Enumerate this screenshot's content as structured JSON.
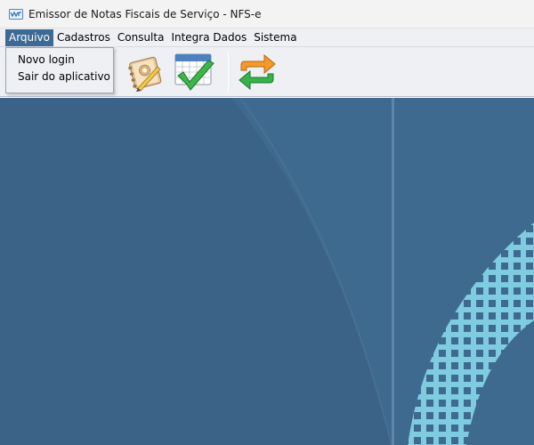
{
  "window": {
    "title": "Emissor de Notas Fiscais de Serviço - NFS-e"
  },
  "menubar": {
    "items": [
      {
        "label": "Arquivo"
      },
      {
        "label": "Cadastros"
      },
      {
        "label": "Consulta"
      },
      {
        "label": "Integra Dados"
      },
      {
        "label": "Sistema"
      }
    ]
  },
  "arquivo_menu": {
    "items": [
      {
        "label": "Novo login"
      },
      {
        "label": "Sair do aplicativo"
      }
    ]
  },
  "toolbar": {
    "icons": [
      "address-book-icon",
      "calendar-check-icon",
      "sync-arrows-icon"
    ]
  },
  "colors": {
    "menu_highlight": "#3d6a94",
    "desktop_background": "#3f6a8f",
    "mesh_pattern": "#7fcbe0"
  }
}
